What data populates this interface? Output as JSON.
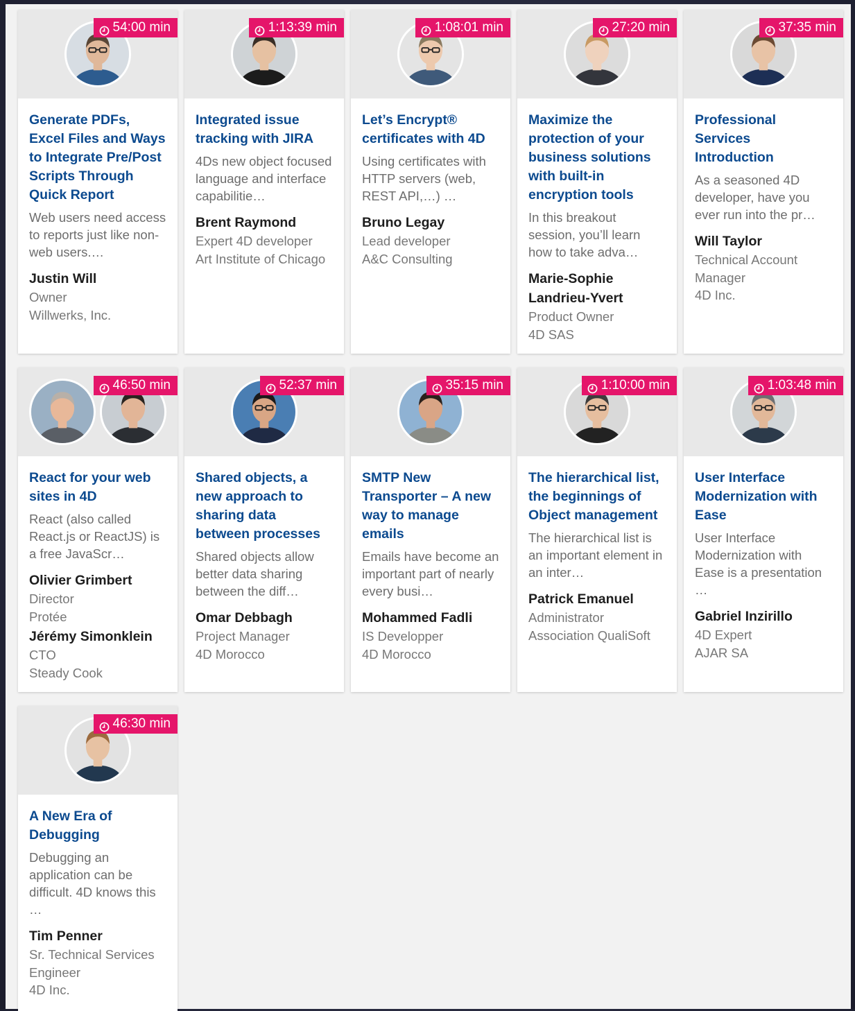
{
  "accent_color": "#e5156a",
  "title_color": "#0c4a8f",
  "sessions": [
    {
      "duration": "54:00 min",
      "title": "Generate PDFs, Excel Files and Ways to Integrate Pre/Post Scripts Through Quick Report",
      "description": "Web users need access to reports just like non-web users.…",
      "speakers": [
        {
          "name": "Justin Will",
          "role": "Owner",
          "org": "Willwerks, Inc."
        }
      ]
    },
    {
      "duration": "1:13:39 min",
      "title": "Integrated issue tracking with JIRA",
      "description": "4Ds new object focused language and interface capabilitie…",
      "speakers": [
        {
          "name": "Brent Raymond",
          "role": "Expert 4D developer",
          "org": "Art Institute of Chicago"
        }
      ]
    },
    {
      "duration": "1:08:01 min",
      "title": "Let’s Encrypt® certificates with 4D",
      "description": "Using certificates with HTTP servers (web, REST API,…) …",
      "speakers": [
        {
          "name": "Bruno Legay",
          "role": "Lead developer",
          "org": "A&C Consulting"
        }
      ]
    },
    {
      "duration": "27:20 min",
      "title": "Maximize the protection of your business solutions with built-in encryption tools",
      "description": "In this breakout session, you’ll learn how to take adva…",
      "speakers": [
        {
          "name": "Marie-Sophie Landrieu-Yvert",
          "role": "Product Owner",
          "org": "4D SAS"
        }
      ]
    },
    {
      "duration": "37:35 min",
      "title": "Professional Services Introduction",
      "description": "As a seasoned 4D developer, have you ever run into the pr…",
      "speakers": [
        {
          "name": "Will Taylor",
          "role": "Technical Account Manager",
          "org": "4D Inc."
        }
      ]
    },
    {
      "duration": "46:50 min",
      "title": "React for your web sites in 4D",
      "description": "React (also called React.js or ReactJS) is a free JavaScr…",
      "speakers": [
        {
          "name": "Olivier Grimbert",
          "role": "Director",
          "org": "Protée"
        },
        {
          "name": "Jérémy Simonklein",
          "role": "CTO",
          "org": "Steady Cook"
        }
      ]
    },
    {
      "duration": "52:37 min",
      "title": "Shared objects, a new approach to sharing data between processes",
      "description": "Shared objects allow better data sharing between the diff…",
      "speakers": [
        {
          "name": "Omar Debbagh",
          "role": "Project Manager",
          "org": "4D Morocco"
        }
      ]
    },
    {
      "duration": "35:15 min",
      "title": "SMTP New Transporter – A new way to manage emails",
      "description": "Emails have become an important part of nearly every busi…",
      "speakers": [
        {
          "name": "Mohammed Fadli",
          "role": "IS Developper",
          "org": "4D Morocco"
        }
      ]
    },
    {
      "duration": "1:10:00 min",
      "title": "The hierarchical list, the beginnings of Object management",
      "description": "The hierarchical list is an important element in an inter…",
      "speakers": [
        {
          "name": "Patrick Emanuel",
          "role": "Administrator",
          "org": "Association QualiSoft"
        }
      ]
    },
    {
      "duration": "1:03:48 min",
      "title": "User Interface Modernization with Ease",
      "description": "User Interface Modernization with Ease is a presentation …",
      "speakers": [
        {
          "name": "Gabriel Inzirillo",
          "role": "4D Expert",
          "org": "AJAR SA"
        }
      ]
    },
    {
      "duration": "46:30 min",
      "title": "A New Era of Debugging",
      "description": "Debugging an application can be difficult. 4D knows this …",
      "speakers": [
        {
          "name": "Tim Penner",
          "role": "Sr. Technical Services Engineer",
          "org": "4D Inc."
        }
      ]
    }
  ]
}
